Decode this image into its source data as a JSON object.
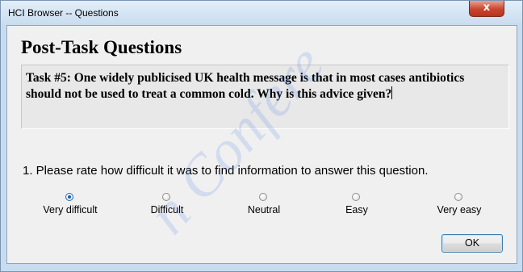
{
  "window": {
    "title": "HCI Browser -- Questions",
    "close_glyph": "x"
  },
  "dialog": {
    "heading": "Post-Task Questions",
    "task_text": "Task #5: One widely publicised UK health message is that in most cases antibiotics should not be used to treat a common cold. Why is this advice given?",
    "question": "1. Please rate how difficult it was to find information to answer this question.",
    "rating": {
      "options": [
        "Very difficult",
        "Difficult",
        "Neutral",
        "Easy",
        "Very easy"
      ],
      "selected_index": 0
    },
    "ok_label": "OK"
  },
  "watermark_text": "n Confere",
  "colors": {
    "window_frame": "#c7dcef",
    "client_bg": "#f0f0f0",
    "close_button": "#c9452f",
    "radio_selected": "#1f5a9a"
  }
}
